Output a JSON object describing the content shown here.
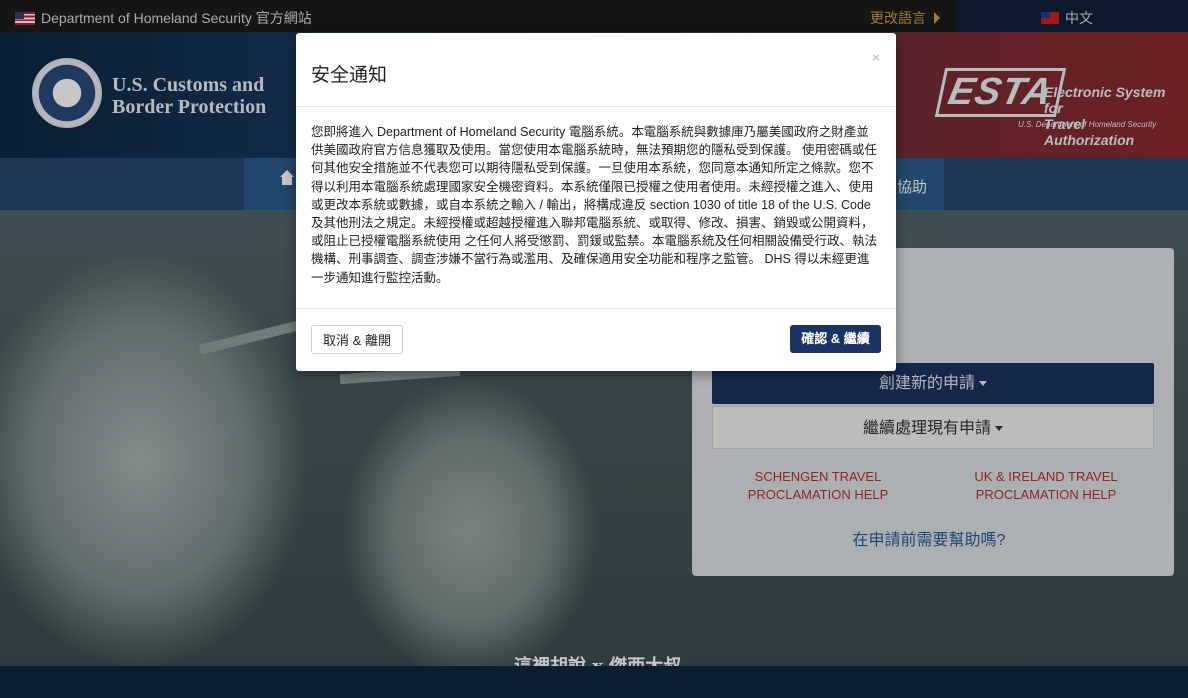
{
  "topbar": {
    "dhs_label": "Department of Homeland Security 官方網站",
    "change_language": "更改語言",
    "current_language": "中文"
  },
  "banner": {
    "cbp_line1": "U.S. Customs and",
    "cbp_line2": "Border Protection",
    "esta_logo": "ESTA",
    "esta_title_line1": "Electronic System for",
    "esta_title_line2": "Travel Authorization",
    "esta_subtitle": "U.S. Department of Homeland Security"
  },
  "nav": {
    "help_fragment": "協助"
  },
  "panel": {
    "create_new": "創建新的申請",
    "continue_existing": "繼續處理現有申請",
    "schengen_line1": "SCHENGEN TRAVEL",
    "schengen_line2": "PROCLAMATION HELP",
    "uk_line1": "UK & IRELAND TRAVEL",
    "uk_line2": "PROCLAMATION HELP",
    "help_link": "在申請前需要幫助嗎?"
  },
  "watermark": "這裡胡說 x 傑西大叔",
  "modal": {
    "title": "安全通知",
    "close": "×",
    "body": "您即將進入 Department of Homeland Security 電腦系統。本電腦系統與數據庫乃屬美國政府之財產並供美國政府官方信息獲取及使用。當您使用本電腦系統時，無法預期您的隱私受到保護。 使用密碼或任何其他安全措施並不代表您可以期待隱私受到保護。一旦使用本系統，您同意本通知所定之條款。您不得以利用本電腦系統處理國家安全機密資料。本系統僅限已授權之使用者使用。未經授權之進入、使用或更改本系統或數據，或自本系統之輸入 / 輸出，將構成違反 section 1030 of title 18 of the U.S. Code 及其他刑法之規定。未經授權或超越授權進入聯邦電腦系統、或取得、修改、損害、銷毀或公開資料，或阻止已授權電腦系統使用 之任何人將受懲罰、罰鍰或監禁。本電腦系統及任何相關設備受行政、執法機構、刑事調查、調查涉嫌不當行為或濫用、及確保適用安全功能和程序之監管。 DHS 得以未經更進一步通知進行監控活動。",
    "cancel": "取消 & 離開",
    "confirm": "確認 & 繼續"
  }
}
